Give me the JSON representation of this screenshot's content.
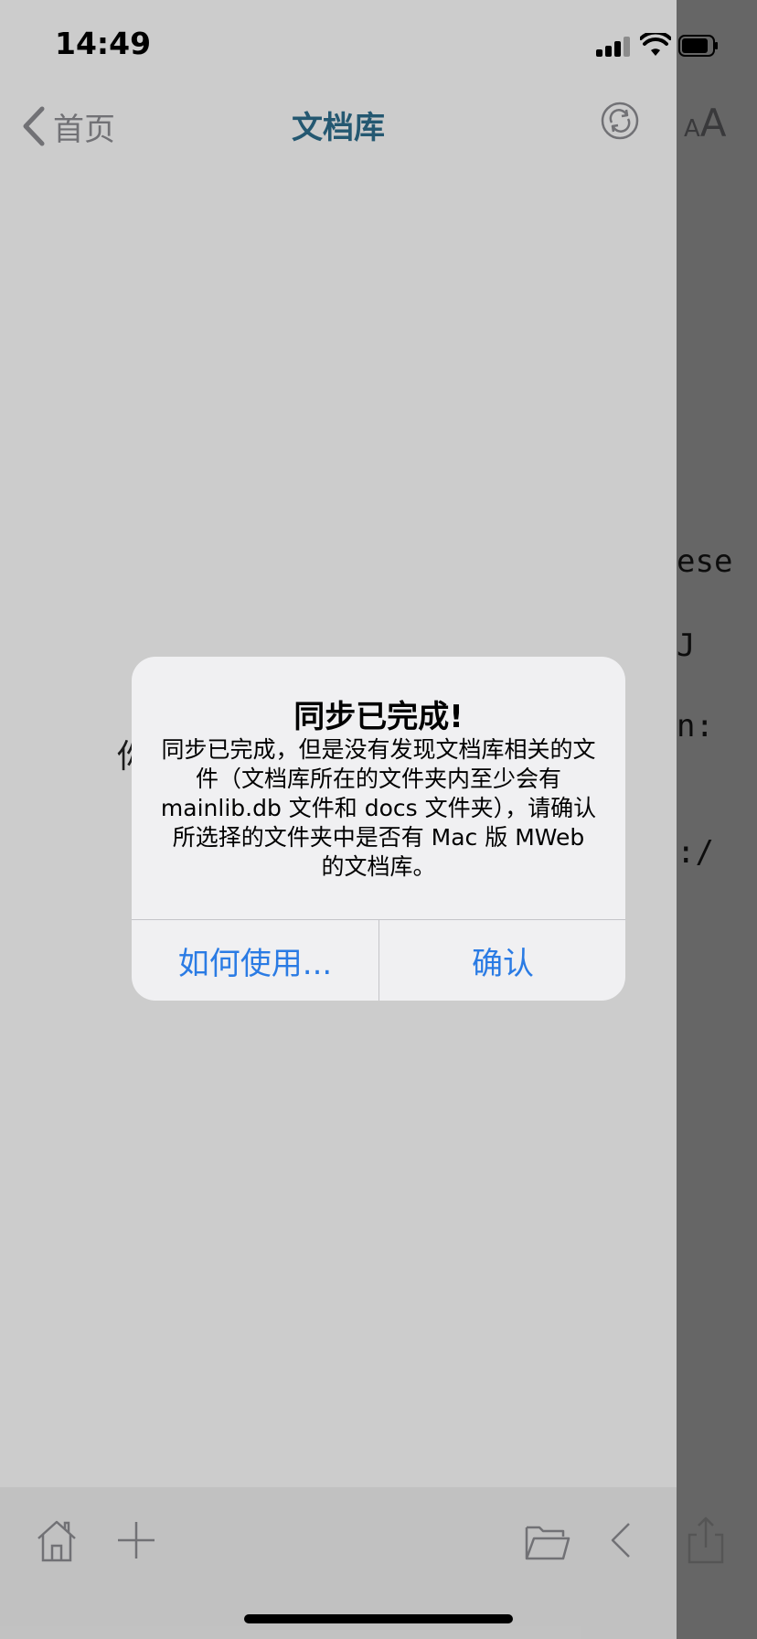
{
  "status_bar": {
    "time": "14:49"
  },
  "nav": {
    "back_label": "首页",
    "title": "文档库",
    "title_color": "#2e6e8e"
  },
  "right_panel": {
    "aa_small": "A",
    "aa_big": "A",
    "fragments": [
      "ese",
      "J",
      "n:",
      ":/"
    ]
  },
  "content": {
    "fragment": "你"
  },
  "alert": {
    "title": "同步已完成!",
    "message": "同步已完成，但是没有发现文档库相关的文件（文档库所在的文件夹内至少会有 mainlib.db 文件和 docs 文件夹），请确认所选择的文件夹中是否有 Mac 版 MWeb 的文档库。",
    "buttons": {
      "help": "如何使用...",
      "confirm": "确认"
    },
    "button_color": "#2a7be4"
  },
  "toolbar": {
    "icons": [
      "home-icon",
      "plus-icon",
      "folder-icon",
      "chevron-left-icon",
      "share-icon"
    ]
  }
}
